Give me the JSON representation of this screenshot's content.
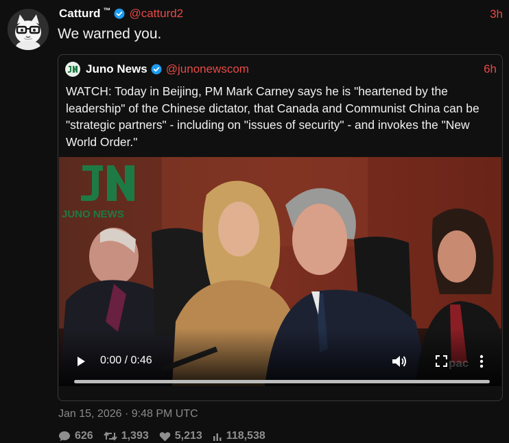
{
  "tweet": {
    "author_name": "Catturd",
    "trademark": "™",
    "handle": "@catturd2",
    "time": "3h",
    "text": "We warned you.",
    "date": "Jan 15, 2026 · 9:48 PM UTC",
    "stats": {
      "replies": "626",
      "retweets": "1,393",
      "likes": "5,213",
      "views": "118,538"
    }
  },
  "quote": {
    "author_name": "Juno News",
    "handle": "@junonewscom",
    "time": "6h",
    "text": "WATCH: Today in Beijing, PM Mark Carney says he is \"heartened by the leadership\" of the Chinese dictator, that Canada and Communist China can be \"strategic partners\" - including on \"issues of security\" - and invokes the \"New World Order.\""
  },
  "video": {
    "time_display": "0:00 / 0:46",
    "watermark": "JUNO NEWS",
    "corner_mark": "pac",
    "progress": 0
  },
  "colors": {
    "background": "#0f0f0f",
    "handle_accent": "#e84a47",
    "verified_badge": "#1d9bf0",
    "brand_green": "#1e7a44"
  },
  "icons": [
    "verified-icon",
    "play-icon",
    "volume-icon",
    "fullscreen-icon",
    "more-vertical-icon",
    "reply-icon",
    "retweet-icon",
    "like-icon",
    "views-icon"
  ]
}
